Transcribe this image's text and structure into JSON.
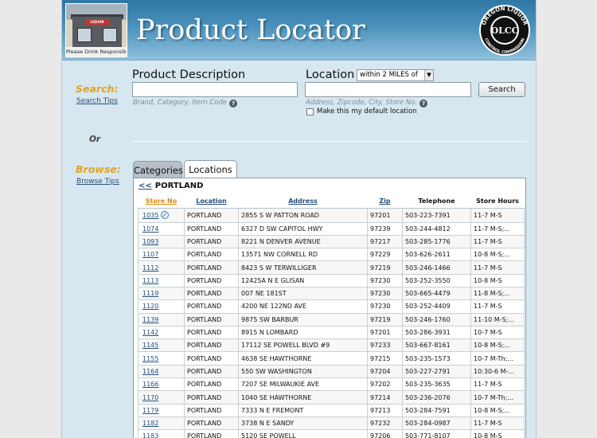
{
  "header": {
    "title": "Product Locator",
    "store_logo_caption": "Please Drink Responsibly",
    "store_sign_text": "LIQUOR",
    "seal": {
      "top_text": "OREGON LIQUOR",
      "bottom_text": "CONTROL COMMISSION",
      "center_text": "OLCC"
    }
  },
  "search": {
    "label": "Search:",
    "tips_label": "Search Tips",
    "product_title": "Product Description",
    "product_value": "",
    "product_hint": "Brand, Category, Item Code",
    "location_title": "Location",
    "distance_selected": "within 2 MILES of",
    "location_value": "",
    "location_hint": "Address, Zipcode, City, Store No.",
    "search_button": "Search",
    "default_location_label": "Make this my default location",
    "default_location_checked": false
  },
  "or_label": "Or",
  "browse": {
    "label": "Browse:",
    "tips_label": "Browse Tips",
    "tabs": [
      {
        "label": "Categories",
        "active": false
      },
      {
        "label": "Locations",
        "active": true
      }
    ],
    "breadcrumb_back": "<<",
    "breadcrumb_city": "PORTLAND"
  },
  "table": {
    "columns": [
      "Store No",
      "Location",
      "Address",
      "Zip",
      "Telephone",
      "Store Hours"
    ],
    "rows": [
      {
        "store": "1035",
        "city": "PORTLAND",
        "address": "2855 S W PATTON ROAD",
        "zip": "97201",
        "phone": "503-223-7391",
        "hours": "11-7 M-S"
      },
      {
        "store": "1074",
        "city": "PORTLAND",
        "address": "6327 D SW CAPITOL HWY",
        "zip": "97239",
        "phone": "503-244-4812",
        "hours": "11-7 M-S;..."
      },
      {
        "store": "1093",
        "city": "PORTLAND",
        "address": "8221 N DENVER AVENUE",
        "zip": "97217",
        "phone": "503-285-1776",
        "hours": "11-7 M-S"
      },
      {
        "store": "1107",
        "city": "PORTLAND",
        "address": "13571 NW CORNELL RD",
        "zip": "97229",
        "phone": "503-626-2611",
        "hours": "10-8 M-S;..."
      },
      {
        "store": "1112",
        "city": "PORTLAND",
        "address": "8423 S W TERWILLIGER",
        "zip": "97219",
        "phone": "503-246-1466",
        "hours": "11-7 M-S"
      },
      {
        "store": "1113",
        "city": "PORTLAND",
        "address": "12425A N E GLISAN",
        "zip": "97230",
        "phone": "503-252-3550",
        "hours": "10-8 M-S"
      },
      {
        "store": "1119",
        "city": "PORTLAND",
        "address": "007 NE 181ST",
        "zip": "97230",
        "phone": "503-665-4479",
        "hours": "11-8 M-S;..."
      },
      {
        "store": "1120",
        "city": "PORTLAND",
        "address": "4200 NE 122ND AVE",
        "zip": "97230",
        "phone": "503-252-4409",
        "hours": "11-7 M-S"
      },
      {
        "store": "1139",
        "city": "PORTLAND",
        "address": "9875 SW BARBUR",
        "zip": "97219",
        "phone": "503-246-1760",
        "hours": "11-10 M-S;..."
      },
      {
        "store": "1142",
        "city": "PORTLAND",
        "address": "8915 N LOMBARD",
        "zip": "97201",
        "phone": "503-286-3931",
        "hours": "10-7 M-S"
      },
      {
        "store": "1145",
        "city": "PORTLAND",
        "address": "17112 SE POWELL BLVD #9",
        "zip": "97233",
        "phone": "503-667-8161",
        "hours": "10-8 M-S;..."
      },
      {
        "store": "1155",
        "city": "PORTLAND",
        "address": "4638 SE HAWTHORNE",
        "zip": "97215",
        "phone": "503-235-1573",
        "hours": "10-7 M-Th;..."
      },
      {
        "store": "1164",
        "city": "PORTLAND",
        "address": "550 SW WASHINGTON",
        "zip": "97204",
        "phone": "503-227-2791",
        "hours": "10:30-6 M-..."
      },
      {
        "store": "1166",
        "city": "PORTLAND",
        "address": "7207 SE MILWAUKIE AVE",
        "zip": "97202",
        "phone": "503-235-3635",
        "hours": "11-7 M-S"
      },
      {
        "store": "1170",
        "city": "PORTLAND",
        "address": "1040 SE HAWTHORNE",
        "zip": "97214",
        "phone": "503-236-2076",
        "hours": "10-7 M-Th;..."
      },
      {
        "store": "1179",
        "city": "PORTLAND",
        "address": "7333 N E FREMONT",
        "zip": "97213",
        "phone": "503-284-7591",
        "hours": "10-8 M-S;..."
      },
      {
        "store": "1182",
        "city": "PORTLAND",
        "address": "3738 N E SANDY",
        "zip": "97232",
        "phone": "503-284-0987",
        "hours": "11-7 M-S"
      },
      {
        "store": "1183",
        "city": "PORTLAND",
        "address": "5120 SE POWELL",
        "zip": "97206",
        "phone": "503-771-8107",
        "hours": "10-8 M-S"
      }
    ]
  },
  "colors": {
    "section_label": "#e7a31a",
    "link": "#24507a",
    "header_top": "#2f77a4",
    "page_bg": "#d7e7ef"
  }
}
